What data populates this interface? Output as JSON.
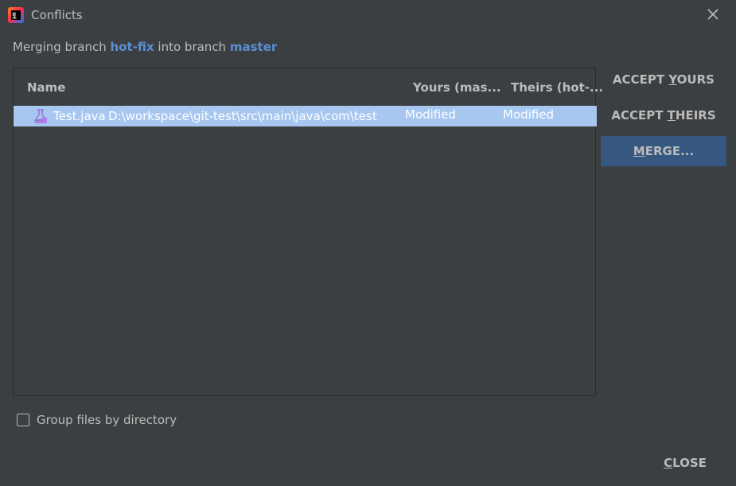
{
  "window": {
    "title": "Conflicts",
    "close_icon": "close-icon",
    "app_icon": "intellij-idea-icon"
  },
  "subtitle": {
    "prefix": "Merging branch ",
    "source_branch": "hot-fix",
    "middle": " into branch ",
    "target_branch": "master"
  },
  "table": {
    "headers": {
      "name": "Name",
      "yours": "Yours (mas...",
      "theirs": "Theirs (hot-..."
    },
    "rows": [
      {
        "icon": "java-file-icon",
        "file": "Test.java",
        "path": "D:\\workspace\\git-test\\src\\main\\java\\com\\test",
        "yours": "Modified",
        "theirs": "Modified",
        "selected": true
      }
    ]
  },
  "actions": {
    "accept_yours": {
      "before": "ACCEPT ",
      "mnemonic": "Y",
      "after": "OURS"
    },
    "accept_theirs": {
      "before": "ACCEPT ",
      "mnemonic": "T",
      "after": "HEIRS"
    },
    "merge": {
      "before": "",
      "mnemonic": "M",
      "after": "ERGE..."
    }
  },
  "options": {
    "group_by_directory": {
      "label": "Group files by directory",
      "checked": false
    }
  },
  "footer": {
    "close": {
      "mnemonic": "C",
      "after": "LOSE"
    }
  },
  "colors": {
    "background": "#3c3f41",
    "selection": "#a7c7f0",
    "accent_button": "#365880",
    "branch_link": "#5a8fd4"
  }
}
